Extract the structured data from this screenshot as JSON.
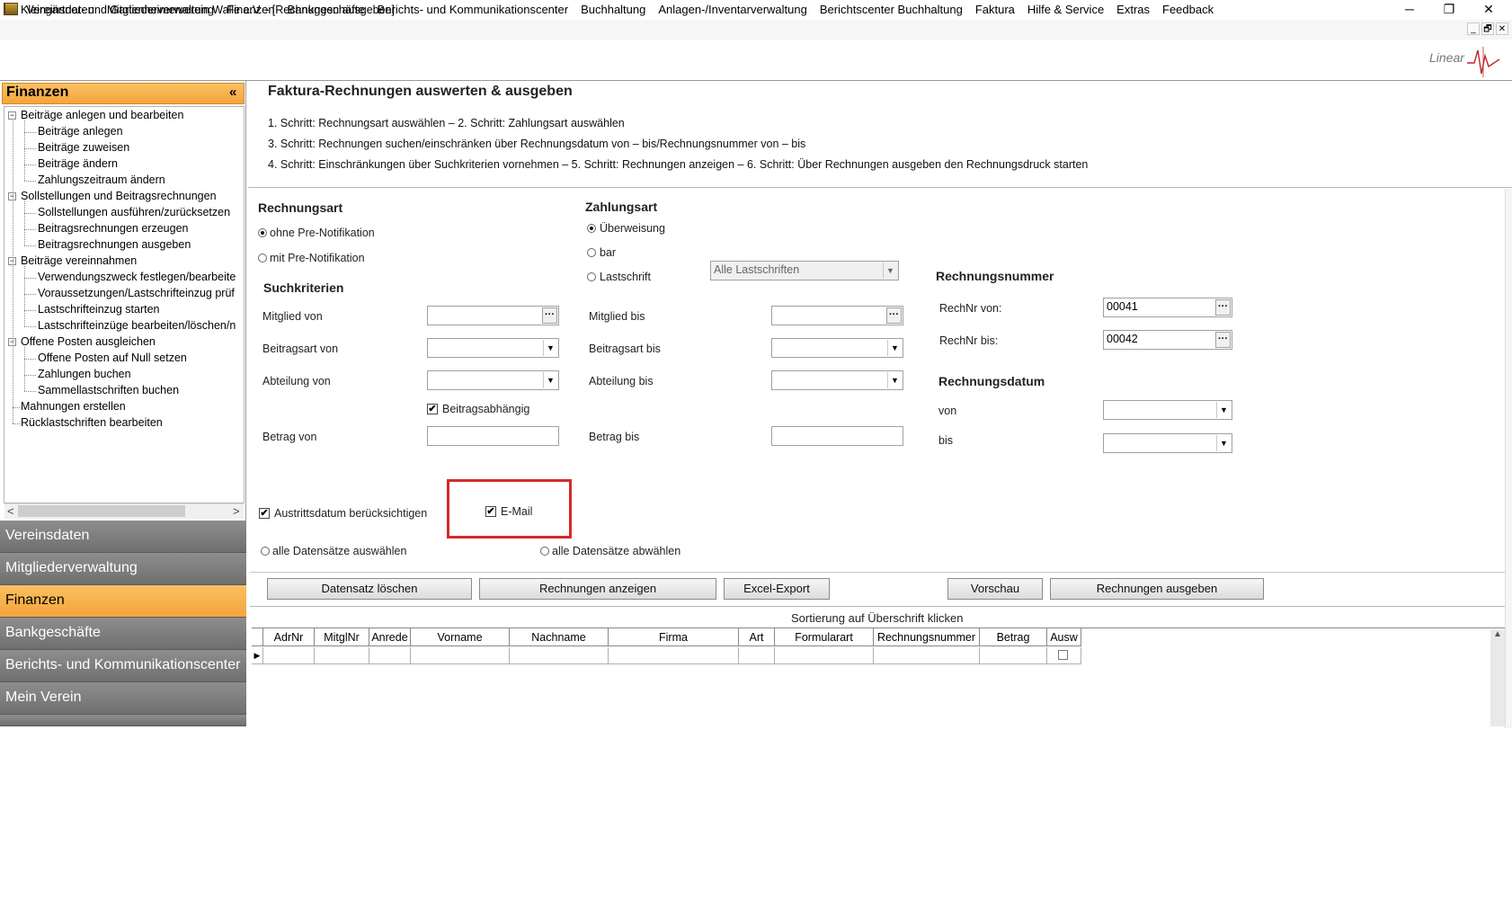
{
  "window": {
    "title": "Kleingärtner- und Gartenheimerverein Walle e.V. - [Rechnungen ausgeben]",
    "minimize": "─",
    "restore": "❐",
    "close": "✕"
  },
  "menu": [
    "Vereinsdaten",
    "Mitgliederverwaltung",
    "Finanzen",
    "Bankgeschäfte",
    "Berichts- und Kommunikationscenter",
    "Buchhaltung",
    "Anlagen-/Inventarverwaltung",
    "Berichtscenter Buchhaltung",
    "Faktura",
    "Hilfe & Service",
    "Extras",
    "Feedback"
  ],
  "mdi": {
    "minimize": "_",
    "restore": "🗗",
    "close": "✕"
  },
  "logo": "Linear",
  "sidebar": {
    "header": "Finanzen",
    "collapse": "«",
    "tree": [
      {
        "label": "Beiträge anlegen und bearbeiten",
        "level": 0
      },
      {
        "label": "Beiträge anlegen",
        "level": 1
      },
      {
        "label": "Beiträge zuweisen",
        "level": 1
      },
      {
        "label": "Beiträge ändern",
        "level": 1
      },
      {
        "label": "Zahlungszeitraum ändern",
        "level": 1
      },
      {
        "label": "Sollstellungen und Beitragsrechnungen",
        "level": 0
      },
      {
        "label": "Sollstellungen ausführen/zurücksetzen",
        "level": 1
      },
      {
        "label": "Beitragsrechnungen erzeugen",
        "level": 1
      },
      {
        "label": "Beitragsrechnungen ausgeben",
        "level": 1
      },
      {
        "label": "Beiträge vereinnahmen",
        "level": 0
      },
      {
        "label": "Verwendungszweck festlegen/bearbeite",
        "level": 1
      },
      {
        "label": "Voraussetzungen/Lastschrifteinzug prüf",
        "level": 1
      },
      {
        "label": "Lastschrifteinzug starten",
        "level": 1
      },
      {
        "label": "Lastschrifteinzüge bearbeiten/löschen/n",
        "level": 1
      },
      {
        "label": "Offene Posten ausgleichen",
        "level": 0
      },
      {
        "label": "Offene Posten auf Null setzen",
        "level": 1
      },
      {
        "label": "Zahlungen buchen",
        "level": 1
      },
      {
        "label": "Sammellastschriften buchen",
        "level": 1
      },
      {
        "label": "Mahnungen erstellen",
        "level": 0
      },
      {
        "label": "Rücklastschriften bearbeiten",
        "level": 0
      }
    ],
    "nav": [
      "Vereinsdaten",
      "Mitgliederverwaltung",
      "Finanzen",
      "Bankgeschäfte",
      "Berichts- und Kommunikationscenter",
      "Mein Verein"
    ]
  },
  "main": {
    "title": "Faktura-Rechnungen auswerten & ausgeben",
    "steps": [
      "1. Schritt: Rechnungsart auswählen – 2. Schritt: Zahlungsart auswählen",
      "3. Schritt: Rechnungen suchen/einschränken über Rechnungsdatum von – bis/Rechnungsnummer von – bis",
      "4. Schritt: Einschränkungen über Suchkriterien vornehmen  – 5. Schritt: Rechnungen anzeigen – 6. Schritt: Über Rechnungen ausgeben den Rechnungsdruck starten"
    ],
    "rechnungsart": {
      "heading": "Rechnungsart",
      "ohne": "ohne Pre-Notifikation",
      "mit": "mit Pre-Notifikation",
      "selected": "ohne"
    },
    "zahlungsart": {
      "heading": "Zahlungsart",
      "ueberweisung": "Überweisung",
      "bar": "bar",
      "lastschrift": "Lastschrift",
      "selected": "ueberweisung",
      "lastschrift_select": "Alle Lastschriften"
    },
    "suchkriterien": {
      "heading": "Suchkriterien",
      "mitglied_von": "Mitglied von",
      "mitglied_bis": "Mitglied  bis",
      "beitragsart_von": "Beitragsart von",
      "beitragsart_bis": "Beitragsart bis",
      "abteilung_von": "Abteilung von",
      "abteilung_bis": "Abteilung bis",
      "beitragsabhaengig": "Beitragsabhängig",
      "betrag_von": "Betrag von",
      "betrag_bis": "Betrag bis"
    },
    "rechnungsnummer": {
      "heading": "Rechnungsnummer",
      "von_label": "RechNr von:",
      "von_value": "00041",
      "bis_label": "RechNr bis:",
      "bis_value": "00042"
    },
    "rechnungsdatum": {
      "heading": "Rechnungsdatum",
      "von": "von",
      "bis": "bis"
    },
    "austritt": "Austrittsdatum berücksichtigen",
    "email": "E-Mail",
    "alle_auswaehlen": "alle Datensätze auswählen",
    "alle_abwaehlen": "alle Datensätze abwählen",
    "buttons": {
      "loeschen": "Datensatz löschen",
      "anzeigen": "Rechnungen anzeigen",
      "excel": "Excel-Export",
      "vorschau": "Vorschau",
      "ausgeben": "Rechnungen ausgeben"
    },
    "sort_hint": "Sortierung auf Überschrift klicken",
    "grid_columns": [
      "AdrNr",
      "MitglNr",
      "Anrede",
      "Vorname",
      "Nachname",
      "Firma",
      "Art",
      "Formularart",
      "Rechnungsnummer",
      "Betrag",
      "Ausw"
    ]
  },
  "icons": {
    "check": "✔",
    "ellipsis": "···",
    "dropdown": "▼",
    "row_pointer": "▶",
    "scroll_left": "<",
    "scroll_right": ">",
    "scroll_up": "▲"
  }
}
